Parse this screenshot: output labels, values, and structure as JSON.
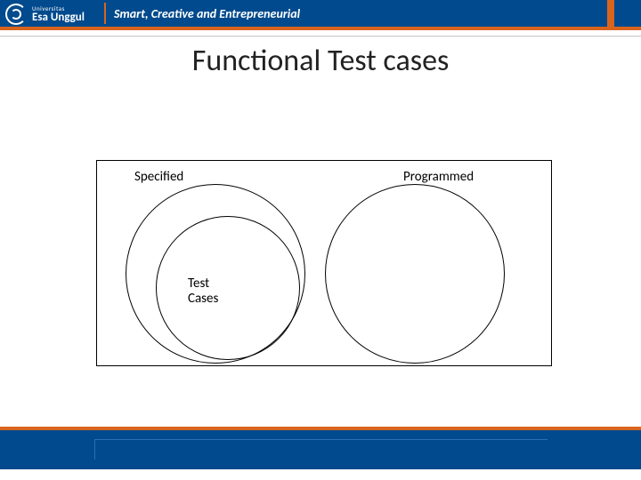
{
  "brand": {
    "sup": "Universitas",
    "name": "Esa Unggul",
    "tagline": "Smart, Creative and Entrepreneurial"
  },
  "slide": {
    "title": "Functional Test cases"
  },
  "diagram": {
    "label_specified": "Specified",
    "label_programmed": "Programmed",
    "label_testcases_l1": "Test",
    "label_testcases_l2": "Cases"
  },
  "colors": {
    "brand_blue": "#004a8d",
    "accent_orange": "#d8641e"
  }
}
